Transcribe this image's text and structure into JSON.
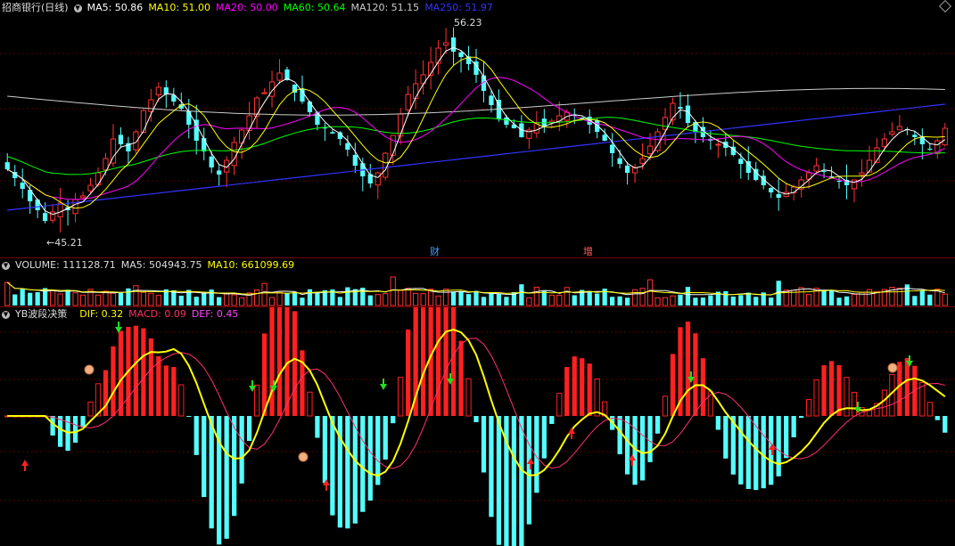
{
  "chart_title": "招商银行(日线)",
  "price_panel": {
    "mas": [
      {
        "label": "MA5: 50.86",
        "color": "#ffffff"
      },
      {
        "label": "MA10: 51.00",
        "color": "#ffff00"
      },
      {
        "label": "MA20: 50.00",
        "color": "#ff00ff"
      },
      {
        "label": "MA60: 50.64",
        "color": "#00ff00"
      },
      {
        "label": "MA120: 51.15",
        "color": "#cccccc"
      },
      {
        "label": "MA250: 51.97",
        "color": "#3333ff"
      }
    ],
    "high_label": "56.23",
    "low_label": "←45.21",
    "event_tags": [
      {
        "text": "财",
        "color": "#3fa0ff"
      },
      {
        "text": "增",
        "color": "#ff6060"
      }
    ]
  },
  "volume_panel": {
    "label": "VOLUME: 111128.71",
    "ma5": "MA5: 504943.75",
    "ma10": "MA10: 661099.69"
  },
  "indicator_panel": {
    "name": "YB波段决策",
    "dif": "DIF: 0.32",
    "macd": "MACD: 0.09",
    "def": "DEF: 0.45"
  },
  "chart_data": {
    "type": "candlestick",
    "ylim": [
      44.5,
      57.2
    ],
    "high": 56.23,
    "low": 45.21,
    "closes": [
      48.5,
      48.0,
      47.4,
      46.7,
      46.2,
      45.6,
      46.1,
      46.6,
      46.2,
      46.8,
      47.0,
      47.6,
      48.3,
      49.1,
      50.2,
      49.9,
      49.5,
      50.6,
      51.8,
      52.4,
      53.1,
      52.7,
      52.3,
      51.9,
      51.0,
      50.1,
      49.5,
      48.6,
      48.2,
      49.0,
      50.0,
      50.7,
      51.5,
      52.5,
      52.8,
      53.4,
      53.9,
      53.5,
      52.8,
      52.3,
      51.7,
      51.0,
      50.8,
      50.5,
      50.2,
      49.6,
      48.7,
      48.1,
      47.7,
      48.3,
      49.4,
      50.4,
      51.6,
      52.7,
      53.3,
      53.8,
      54.5,
      55.3,
      55.6,
      55.1,
      54.8,
      54.4,
      53.8,
      52.9,
      52.1,
      51.3,
      51.0,
      50.8,
      50.3,
      50.7,
      51.1,
      50.9,
      51.2,
      51.5,
      51.7,
      51.5,
      51.3,
      51.0,
      50.6,
      50.1,
      49.4,
      48.8,
      48.3,
      48.6,
      49.1,
      49.8,
      50.6,
      51.4,
      52.2,
      51.9,
      51.1,
      50.6,
      50.3,
      50.1,
      49.9,
      49.7,
      49.3,
      48.8,
      48.3,
      47.9,
      47.6,
      47.2,
      46.9,
      47.2,
      47.5,
      47.9,
      48.3,
      48.7,
      48.4,
      48.1,
      47.8,
      47.6,
      47.9,
      48.3,
      49.0,
      49.7,
      50.2,
      50.6,
      50.9,
      50.7,
      50.3,
      49.9,
      49.6,
      50.1,
      50.8
    ]
  }
}
